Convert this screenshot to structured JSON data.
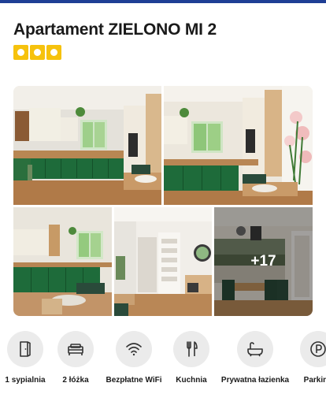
{
  "property": {
    "title": "Apartament ZIELONO MI 2",
    "rating_icon": "star-square-icon",
    "rating_count": 3,
    "accent_color": "#f6c20d",
    "brand_color": "#1f3f95"
  },
  "gallery": {
    "photos": [
      {
        "name": "kitchen-photo-1"
      },
      {
        "name": "kitchen-photo-2"
      },
      {
        "name": "kitchen-photo-3"
      },
      {
        "name": "hallway-photo"
      },
      {
        "name": "dining-photo"
      }
    ],
    "more_label": "+17"
  },
  "amenities": [
    {
      "label": "1 sypialnia",
      "icon": "door-icon"
    },
    {
      "label": "2 łóżka",
      "icon": "bed-icon"
    },
    {
      "label": "Bezpłatne WiFi",
      "icon": "wifi-icon"
    },
    {
      "label": "Kuchnia",
      "icon": "fork-knife-icon"
    },
    {
      "label": "Prywatna łazienka",
      "icon": "bathtub-icon"
    },
    {
      "label": "Parking",
      "icon": "parking-icon"
    }
  ]
}
